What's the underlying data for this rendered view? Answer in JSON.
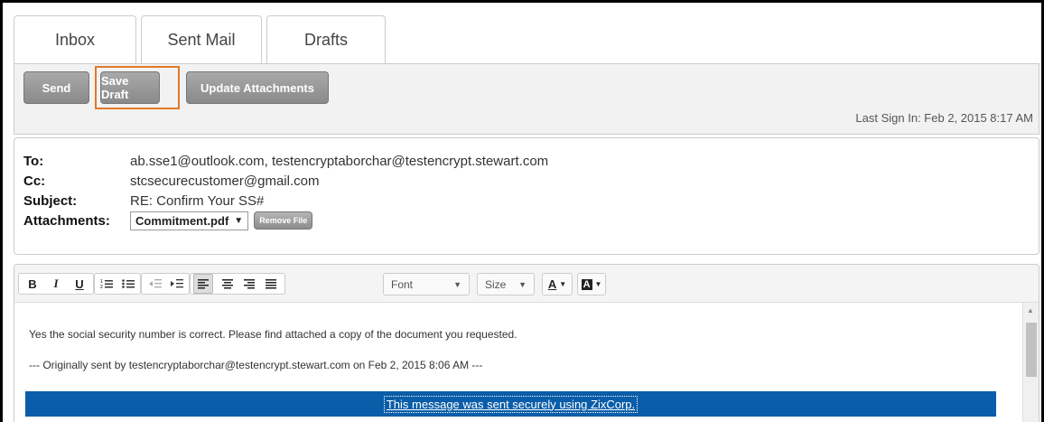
{
  "tabs": [
    {
      "label": "Inbox"
    },
    {
      "label": "Sent Mail"
    },
    {
      "label": "Drafts"
    }
  ],
  "toolbar": {
    "send_label": "Send",
    "save_draft_label": "Save Draft",
    "update_attachments_label": "Update Attachments",
    "last_sign_in": "Last Sign In: Feb 2, 2015 8:17 AM"
  },
  "fields": {
    "to_label": "To:",
    "to_value": "ab.sse1@outlook.com, testencryptaborchar@testencrypt.stewart.com",
    "cc_label": "Cc:",
    "cc_value": "stcsecurecustomer@gmail.com",
    "subject_label": "Subject:",
    "subject_value": "RE: Confirm Your SS#",
    "attachments_label": "Attachments:",
    "attachment_selected": "Commitment.pdf",
    "remove_file_label": "Remove File"
  },
  "editor": {
    "bold": "B",
    "italic": "I",
    "underline": "U",
    "font_select": "Font",
    "size_select": "Size",
    "font_color": "A",
    "bg_color": "A",
    "body_line1": "Yes the social security number is correct.  Please find attached a copy of the document you requested.",
    "body_line2": "--- Originally sent by testencryptaborchar@testencrypt.stewart.com on Feb 2, 2015 8:06 AM ---",
    "banner_text": "This message was sent securely using ZixCorp."
  },
  "colors": {
    "banner": "#0a5da8",
    "highlight": "#e07a2a"
  }
}
